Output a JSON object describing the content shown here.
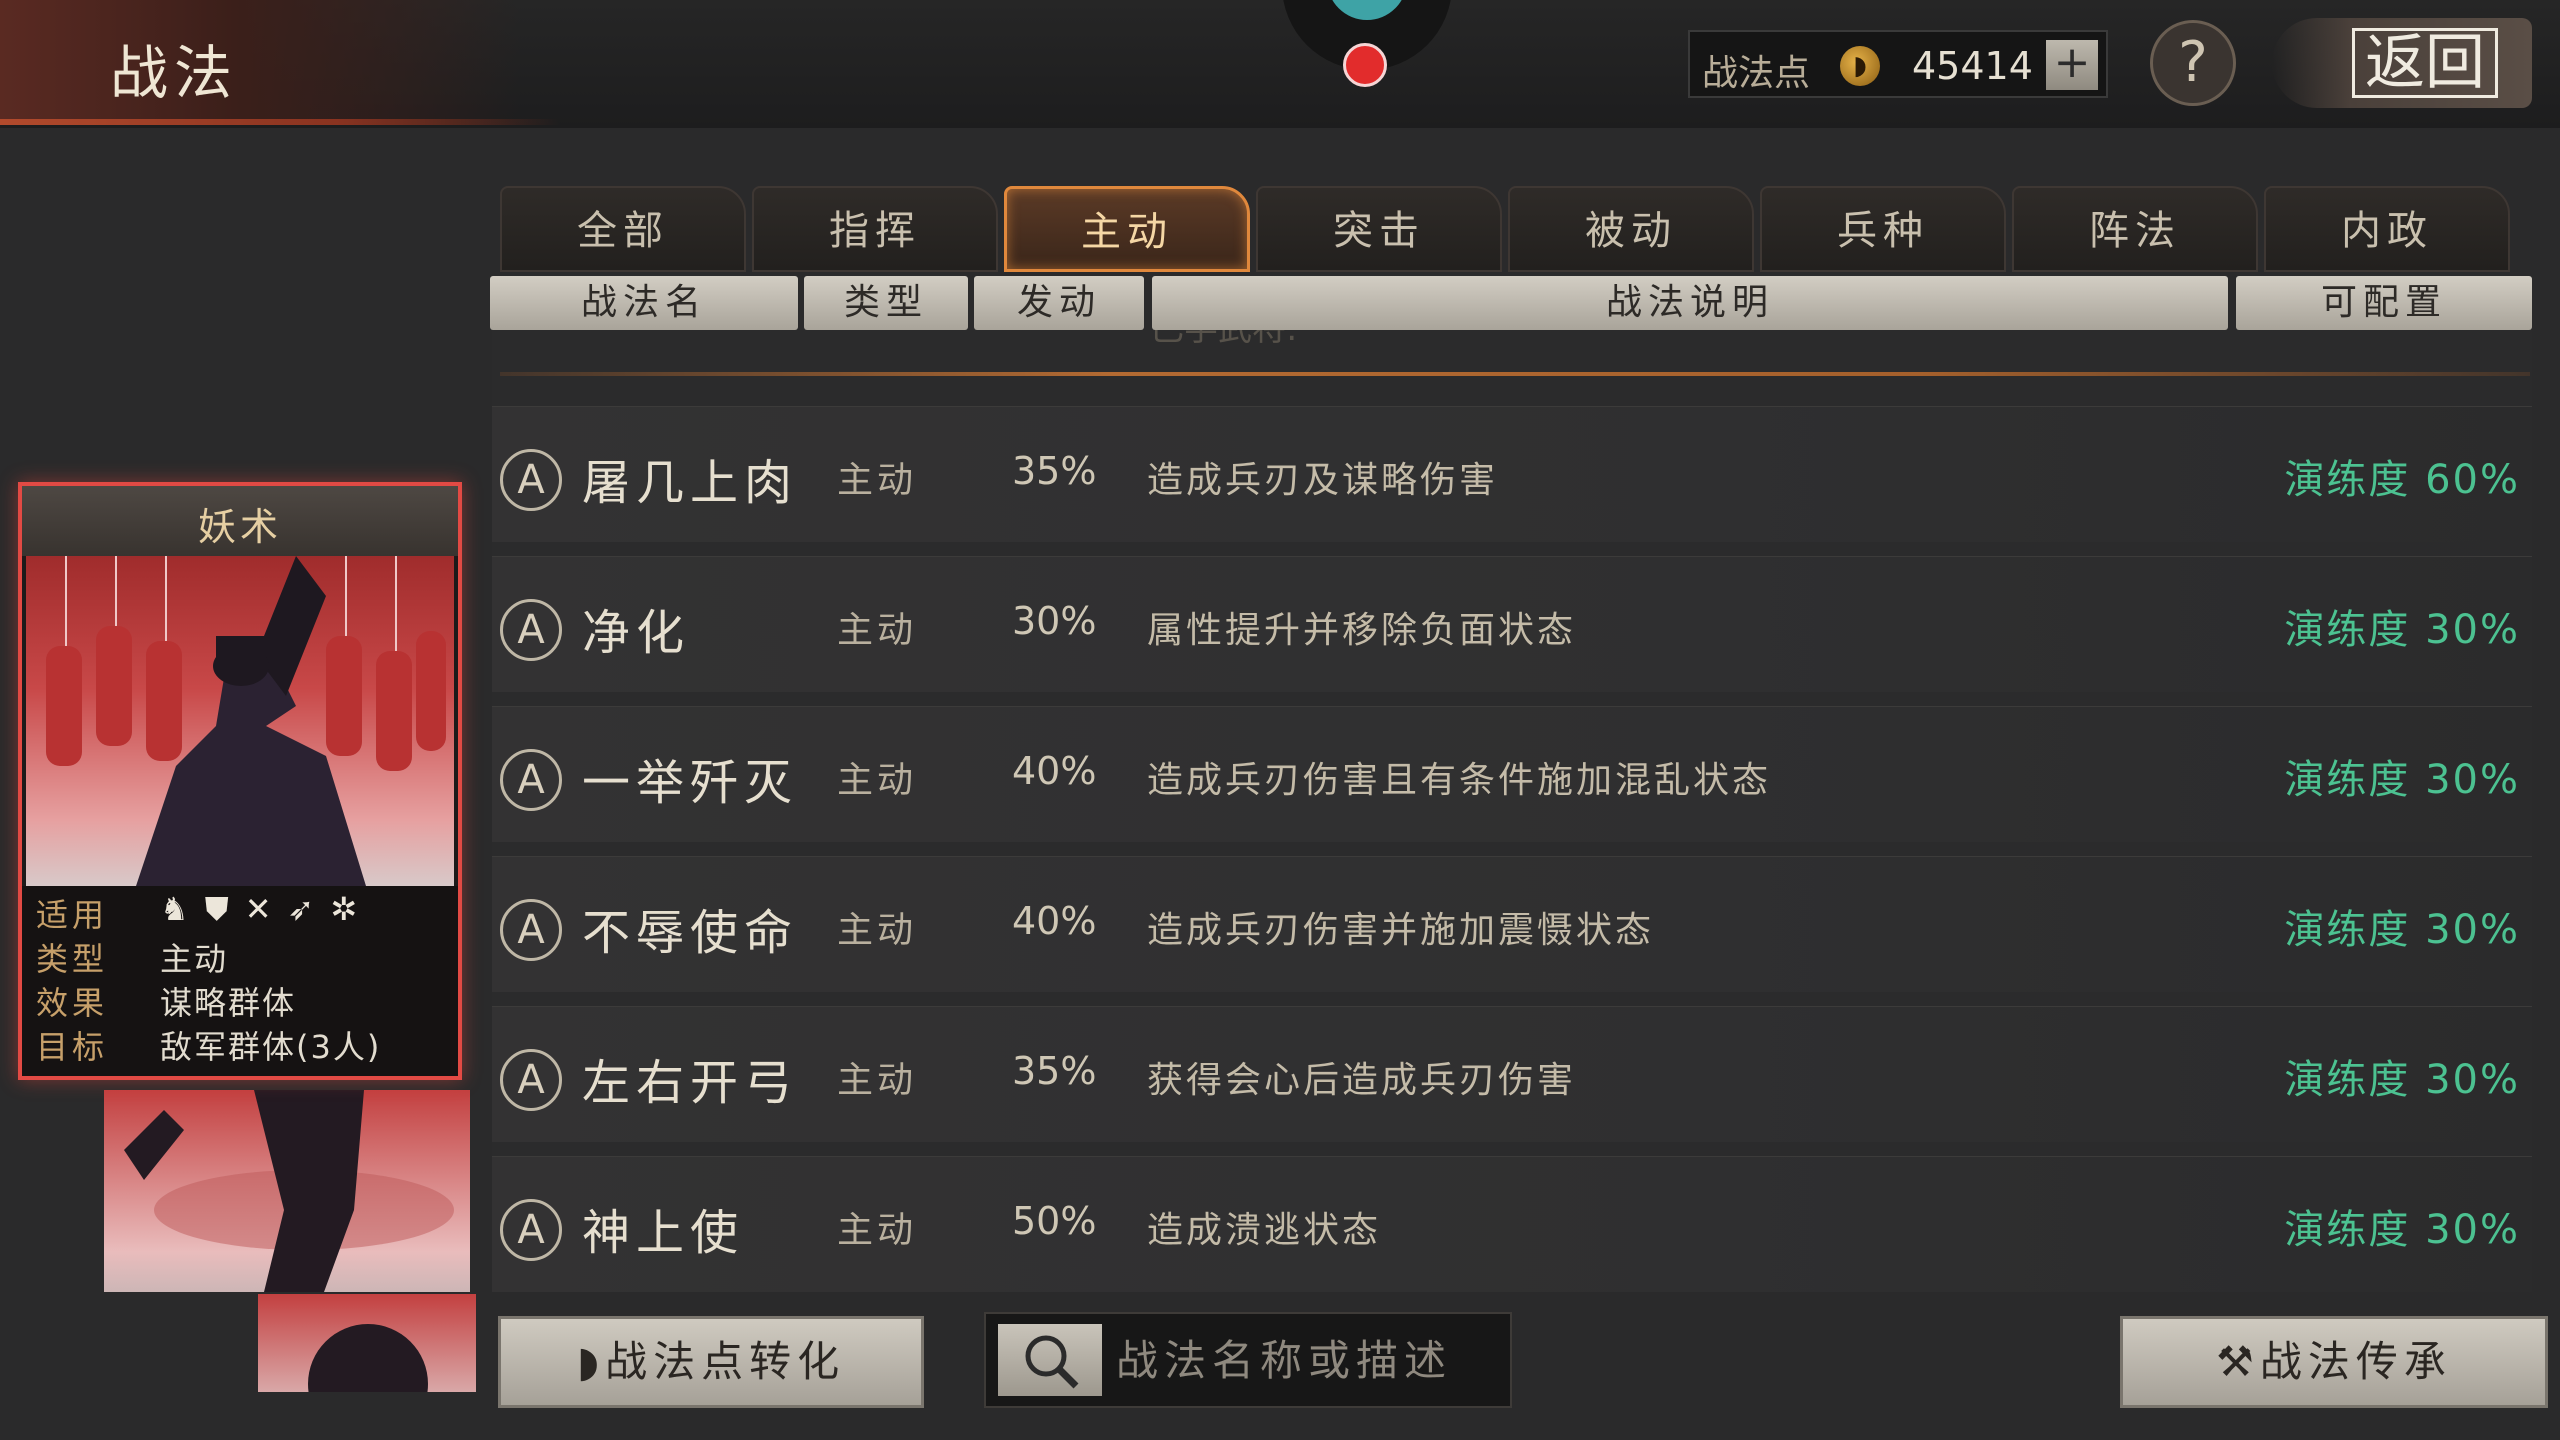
{
  "header": {
    "title": "战法",
    "points_label": "战法点",
    "points_value": "45414",
    "plus_label": "+",
    "help_label": "?",
    "back_label": "返回"
  },
  "tabs": [
    {
      "label": "全部"
    },
    {
      "label": "指挥"
    },
    {
      "label": "主动",
      "active": true
    },
    {
      "label": "突击"
    },
    {
      "label": "被动"
    },
    {
      "label": "兵种"
    },
    {
      "label": "阵法"
    },
    {
      "label": "内政"
    }
  ],
  "columns": {
    "name": "战法名",
    "type": "类型",
    "rate": "发动",
    "desc": "战法说明",
    "config": "可配置"
  },
  "ghost_text": "已学武将:",
  "skills": [
    {
      "grade": "A",
      "name": "屠几上肉",
      "type": "主动",
      "rate": "35%",
      "desc": "造成兵刃及谋略伤害",
      "training": "演练度 60%"
    },
    {
      "grade": "A",
      "name": "净化",
      "type": "主动",
      "rate": "30%",
      "desc": "属性提升并移除负面状态",
      "training": "演练度 30%"
    },
    {
      "grade": "A",
      "name": "一举歼灭",
      "type": "主动",
      "rate": "40%",
      "desc": "造成兵刃伤害且有条件施加混乱状态",
      "training": "演练度 30%"
    },
    {
      "grade": "A",
      "name": "不辱使命",
      "type": "主动",
      "rate": "40%",
      "desc": "造成兵刃伤害并施加震慑状态",
      "training": "演练度 30%"
    },
    {
      "grade": "A",
      "name": "左右开弓",
      "type": "主动",
      "rate": "35%",
      "desc": "获得会心后造成兵刃伤害",
      "training": "演练度 30%"
    },
    {
      "grade": "A",
      "name": "神上使",
      "type": "主动",
      "rate": "50%",
      "desc": "造成溃逃状态",
      "training": "演练度 30%"
    }
  ],
  "card": {
    "title": "妖术",
    "applicable_label": "适用",
    "type_label": "类型",
    "type_value": "主动",
    "effect_label": "效果",
    "effect_value": "谋略群体",
    "target_label": "目标",
    "target_value": "敌军群体(3人)",
    "troop_icons": [
      "cavalry-icon",
      "shield-icon",
      "crossed-spears-icon",
      "bow-icon",
      "wheel-icon"
    ]
  },
  "bottom": {
    "convert_label": "战法点转化",
    "search_placeholder": "战法名称或描述",
    "inherit_label": "战法传承"
  },
  "colors": {
    "accent_orange": "#e0883c",
    "training_green": "#4cc291",
    "card_border_red": "#e24a44"
  }
}
